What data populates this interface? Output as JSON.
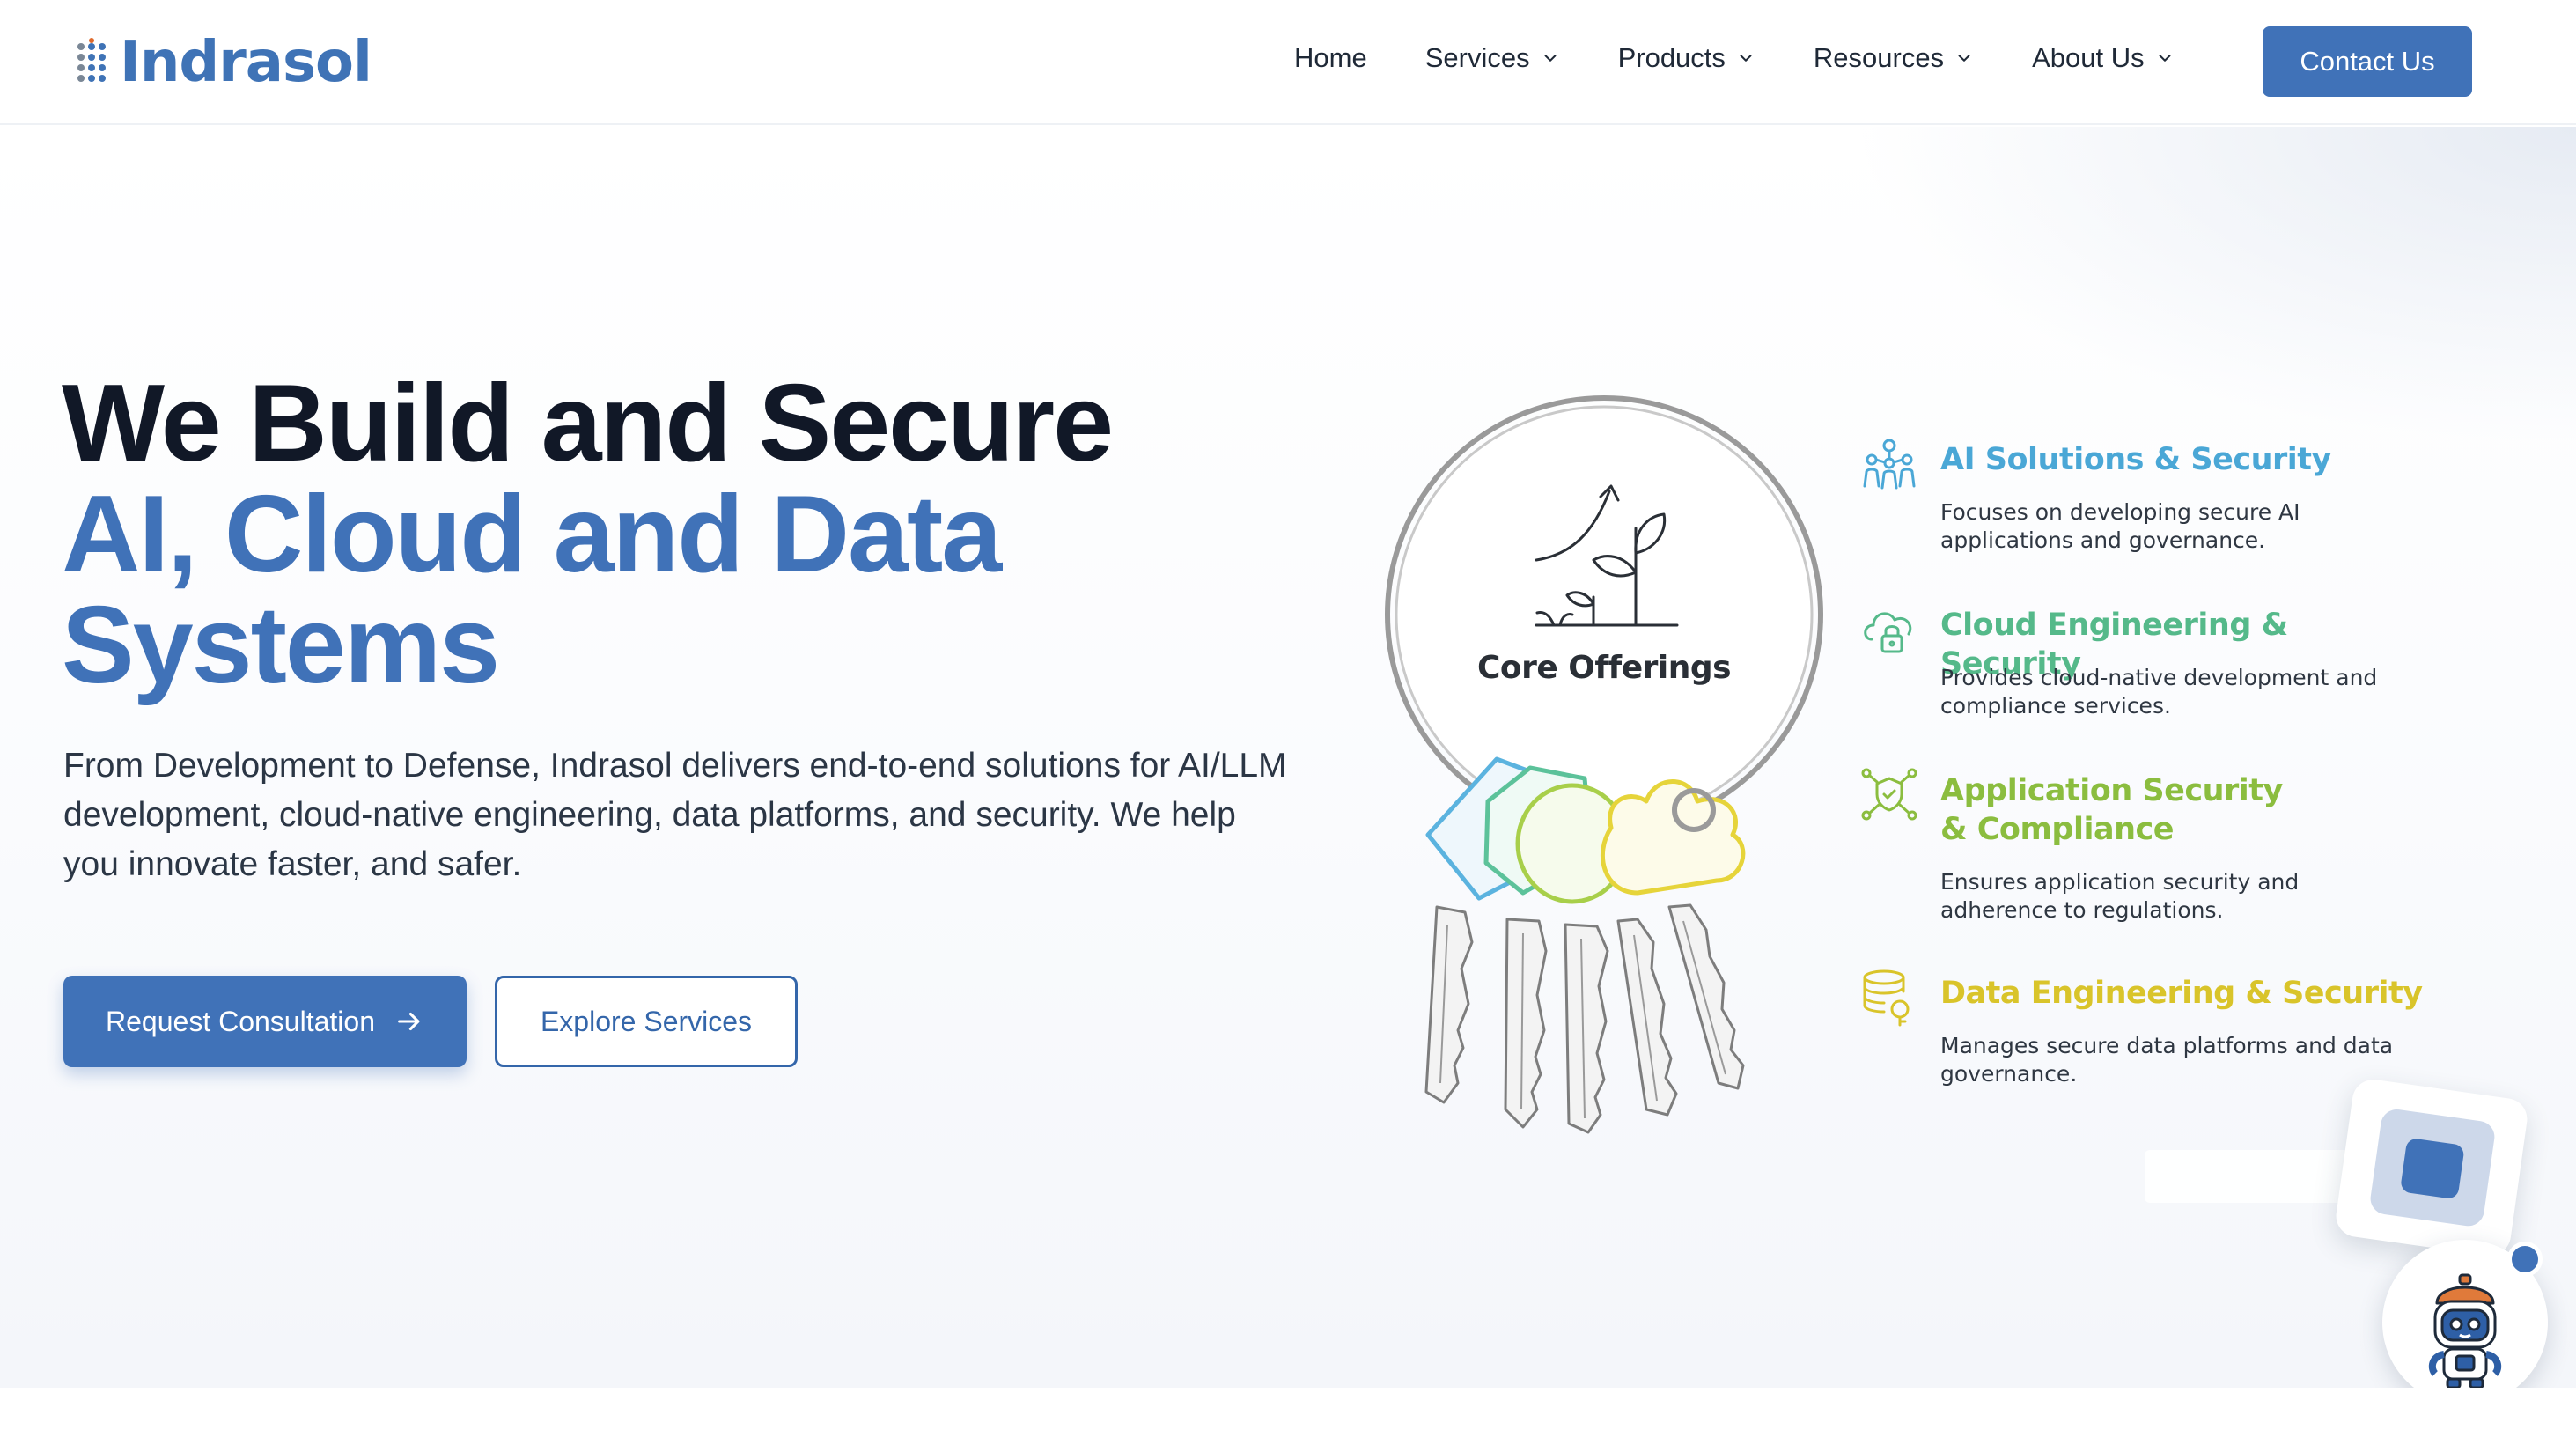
{
  "nav": {
    "logo_text": "Indrasol",
    "links": [
      {
        "label": "Home",
        "has_dropdown": false
      },
      {
        "label": "Services",
        "has_dropdown": true
      },
      {
        "label": "Products",
        "has_dropdown": true
      },
      {
        "label": "Resources",
        "has_dropdown": true
      },
      {
        "label": "About Us",
        "has_dropdown": true
      }
    ],
    "contact_label": "Contact Us"
  },
  "hero": {
    "title_line1": "We Build and Secure",
    "title_line2": "AI, Cloud and Data",
    "title_line3": "Systems",
    "lead": "From Development to Defense, Indrasol delivers end-to-end solutions for AI/LLM development, cloud-native engineering, data platforms, and security. We help you innovate faster, and safer.",
    "primary_cta": "Request Consultation",
    "secondary_cta": "Explore Services"
  },
  "graphic": {
    "center_label": "Core Offerings",
    "icon": "growth-plant-icon"
  },
  "offerings": [
    {
      "title": "AI Solutions & Security",
      "desc": "Focuses on developing secure AI applications and governance.",
      "color": "#4aa7d6",
      "icon": "network-people-icon"
    },
    {
      "title": "Cloud Engineering & Security",
      "desc": "Provides cloud-native development and compliance services.",
      "color": "#55b98a",
      "icon": "cloud-lock-icon"
    },
    {
      "title": "Application Security & Compliance",
      "desc": "Ensures application security and adherence to regulations.",
      "color": "#8bbd3f",
      "icon": "shield-network-icon"
    },
    {
      "title": "Data Engineering & Security",
      "desc": "Manages secure data platforms and data governance.",
      "color": "#d9c42a",
      "icon": "database-key-icon"
    }
  ],
  "colors": {
    "brand_blue": "#4072b8",
    "dark_text": "#111827"
  },
  "chat_widget": {
    "icon": "robot-assistant-icon"
  }
}
